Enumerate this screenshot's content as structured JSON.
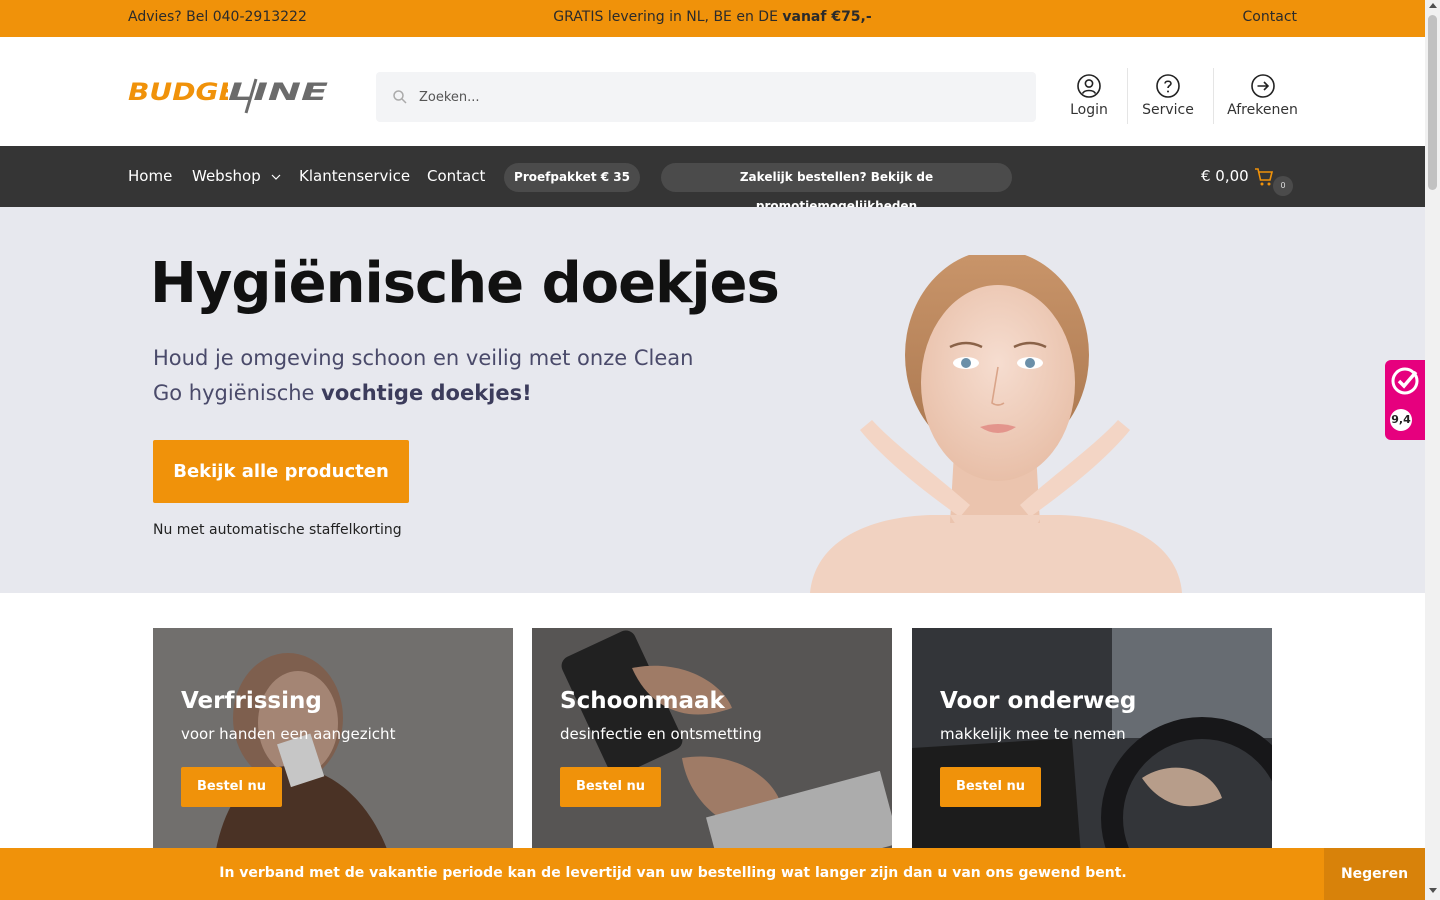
{
  "topbar": {
    "advice": "Advies? Bel 040-2913222",
    "shipping_text": "GRATIS levering in NL, BE en DE ",
    "shipping_bold": "vanaf €75,-",
    "contact": "Contact"
  },
  "header": {
    "logo_text": "BUDGETLINE",
    "search_placeholder": "Zoeken...",
    "buttons": [
      {
        "label": "Login",
        "icon": "user-icon"
      },
      {
        "label": "Service",
        "icon": "help-icon"
      },
      {
        "label": "Afrekenen",
        "icon": "checkout-arrow-icon"
      }
    ]
  },
  "nav": {
    "items": [
      "Home",
      "Webshop",
      "Klantenservice",
      "Contact"
    ],
    "pill_sample": "Proefpakket € 35",
    "pill_business": "Zakelijk bestellen? Bekijk de promotiemogelijkheden",
    "cart_total": "€ 0,00",
    "cart_count": "0"
  },
  "hero": {
    "title": "Hygiënische doekjes",
    "subtitle_text": "Houd je omgeving schoon en veilig met onze Clean Go hygiënische ",
    "subtitle_bold": "vochtige doekjes!",
    "cta": "Bekijk alle producten",
    "note": "Nu met automatische staffelkorting"
  },
  "review": {
    "score": "9,4"
  },
  "cards": [
    {
      "title": "Verfrissing",
      "subtitle": "voor handen een aangezicht",
      "button": "Bestel nu"
    },
    {
      "title": "Schoonmaak",
      "subtitle": "desinfectie en ontsmetting",
      "button": "Bestel nu"
    },
    {
      "title": "Voor onderweg",
      "subtitle": "makkelijk mee te nemen",
      "button": "Bestel nu"
    }
  ],
  "notice": {
    "text": "In verband met de vakantie periode kan de levertijd van uw bestelling wat langer zijn dan u van ons gewend bent.",
    "dismiss": "Negeren"
  },
  "colors": {
    "accent": "#f0920a",
    "nav_bg": "#353535",
    "hero_bg": "#e7e8ee",
    "review_pink": "#e6007e"
  }
}
